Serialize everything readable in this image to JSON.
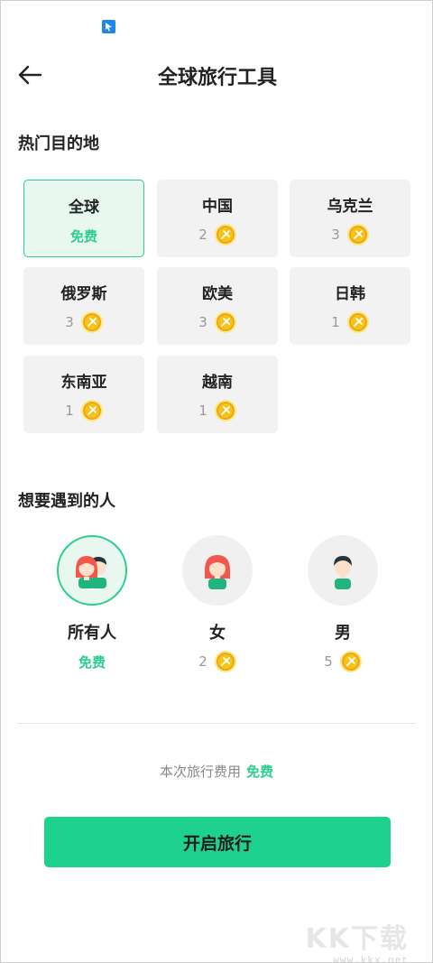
{
  "header": {
    "title": "全球旅行工具"
  },
  "destinations": {
    "title": "热门目的地",
    "items": [
      {
        "name": "全球",
        "free_label": "免费",
        "selected": true
      },
      {
        "name": "中国",
        "price": "2"
      },
      {
        "name": "乌克兰",
        "price": "3"
      },
      {
        "name": "俄罗斯",
        "price": "3"
      },
      {
        "name": "欧美",
        "price": "3"
      },
      {
        "name": "日韩",
        "price": "1"
      },
      {
        "name": "东南亚",
        "price": "1"
      },
      {
        "name": "越南",
        "price": "1"
      }
    ]
  },
  "people": {
    "title": "想要遇到的人",
    "items": [
      {
        "label": "所有人",
        "free_label": "免费",
        "selected": true,
        "icon": "group-avatar-icon"
      },
      {
        "label": "女",
        "price": "2",
        "icon": "female-avatar-icon"
      },
      {
        "label": "男",
        "price": "5",
        "icon": "male-avatar-icon"
      }
    ]
  },
  "cost": {
    "label": "本次旅行费用",
    "value": "免费"
  },
  "start_button": {
    "label": "开启旅行"
  },
  "watermark": {
    "logo": "KK下载",
    "url": "www.kkx.net"
  },
  "colors": {
    "accent": "#1fd18f",
    "accent_text": "#2ccd91",
    "selected_bg": "#e8f8f1",
    "card_bg": "#f2f2f2",
    "coin": "#f7c21b"
  }
}
